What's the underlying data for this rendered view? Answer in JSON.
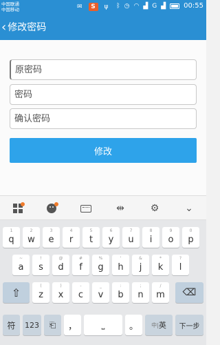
{
  "status_bar": {
    "carriers": [
      "中国联通",
      "中国移动"
    ],
    "network_label": "G",
    "time": "00:55",
    "app_badge": "S"
  },
  "header": {
    "back_icon": "chevron-left",
    "title": "修改密码"
  },
  "form": {
    "old_password_placeholder": "原密码",
    "new_password_placeholder": "密码",
    "confirm_password_placeholder": "确认密码",
    "submit_label": "修改"
  },
  "keyboard_toolbar": {
    "icons": [
      "grid-icon",
      "emoji-icon",
      "keyboard-icon",
      "cursor-icon",
      "gear-icon",
      "chevron-down-icon"
    ],
    "accent_color": "#ef7b2b"
  },
  "keyboard": {
    "row1": [
      {
        "main": "q",
        "alt": "1"
      },
      {
        "main": "w",
        "alt": "2"
      },
      {
        "main": "e",
        "alt": "3"
      },
      {
        "main": "r",
        "alt": "4"
      },
      {
        "main": "t",
        "alt": "5"
      },
      {
        "main": "y",
        "alt": "6"
      },
      {
        "main": "u",
        "alt": "7"
      },
      {
        "main": "i",
        "alt": "8"
      },
      {
        "main": "o",
        "alt": "9"
      },
      {
        "main": "p",
        "alt": "0"
      }
    ],
    "row2": [
      {
        "main": "a",
        "alt": "~"
      },
      {
        "main": "s",
        "alt": "!"
      },
      {
        "main": "d",
        "alt": "@"
      },
      {
        "main": "f",
        "alt": "#"
      },
      {
        "main": "g",
        "alt": "%"
      },
      {
        "main": "h",
        "alt": "'"
      },
      {
        "main": "j",
        "alt": "&"
      },
      {
        "main": "k",
        "alt": "*"
      },
      {
        "main": "l",
        "alt": "?"
      }
    ],
    "row3": [
      {
        "main": "z",
        "alt": "("
      },
      {
        "main": "x",
        "alt": ")"
      },
      {
        "main": "c",
        "alt": "-"
      },
      {
        "main": "v",
        "alt": "_"
      },
      {
        "main": "b",
        "alt": ":"
      },
      {
        "main": "n",
        "alt": ";"
      },
      {
        "main": "m",
        "alt": "/"
      }
    ],
    "bottom": {
      "symbols": "符",
      "numbers": "123",
      "comma": "，",
      "period": "。",
      "lang_cn": "中",
      "lang_en": "英",
      "next": "下一步"
    }
  },
  "colors": {
    "header_blue": "#2a8fd3",
    "button_blue": "#2ea3ea"
  }
}
